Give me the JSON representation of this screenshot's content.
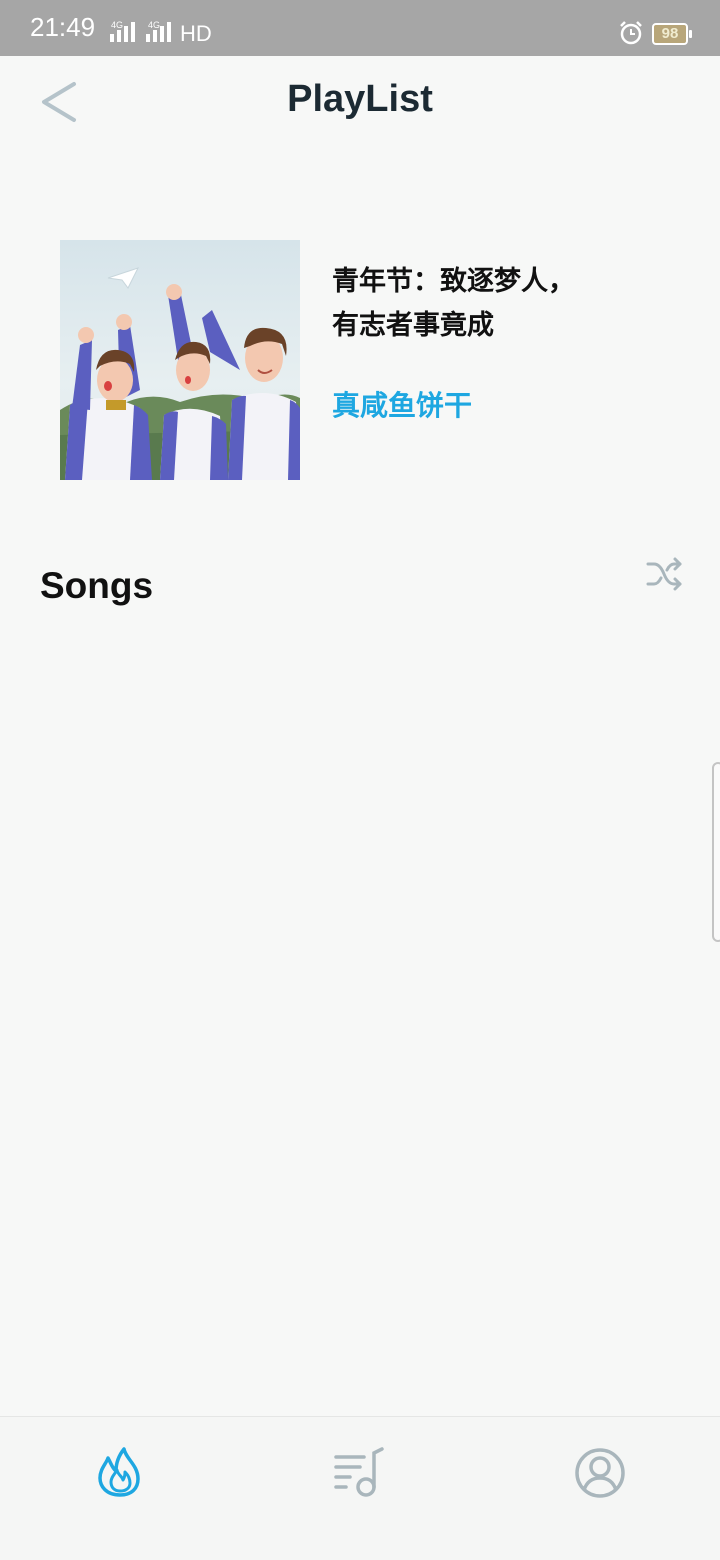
{
  "status_bar": {
    "time": "21:49",
    "network_1": "4G",
    "network_2": "4G",
    "hd": "HD",
    "battery": "98"
  },
  "header": {
    "title": "PlayList",
    "back_icon": "chevron-left-icon"
  },
  "playlist": {
    "title_line1": "青年节：致逐梦人，",
    "title_line2": "有志者事竟成",
    "author": "真咸鱼饼干",
    "cover_image": "illustration of three students in blue-and-white uniforms raising fists"
  },
  "songs": {
    "heading": "Songs",
    "shuffle_icon": "shuffle-icon",
    "items": []
  },
  "bottom_nav": {
    "items": [
      {
        "icon": "flame-icon",
        "active": true
      },
      {
        "icon": "playlist-music-icon",
        "active": false
      },
      {
        "icon": "user-profile-icon",
        "active": false
      }
    ]
  },
  "colors": {
    "accent": "#1ea7e1",
    "icon_inactive": "#a9b6bc",
    "status_bar": "#a6a6a6",
    "background": "#f7f8f7"
  }
}
